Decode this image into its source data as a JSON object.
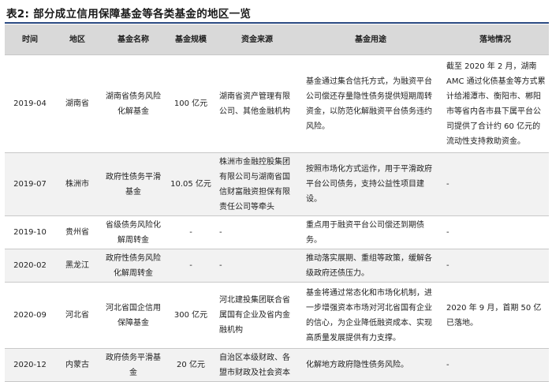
{
  "title": "表2: 部分成立信用保障基金等各类基金的地区一览",
  "headers": [
    "时间",
    "地区",
    "基金名称",
    "基金规模",
    "资金来源",
    "基金用途",
    "落地情况"
  ],
  "rows": [
    {
      "time": "2019-04",
      "region": "湖南省",
      "name": "湖南省债务风险化解基金",
      "scale": "100 亿元",
      "source": "湖南省资产管理有限公司、其他金融机构",
      "purpose": "基金通过集合信托方式，为融资平台公司偿还存量隐性债务提供短期周转资金，以防范化解融资平台债务违约风险。",
      "status": "截至 2020 年 2 月，湖南 AMC 通过化债基金等方式累计给湘潭市、衡阳市、郴阳市等省内各市县下属平台公司提供了合计约 60 亿元的流动性支持救助资金。"
    },
    {
      "time": "2019-07",
      "region": "株洲市",
      "name": "政府性债务平滑基金",
      "scale": "10.05 亿元",
      "source": "株洲市金融控股集团有限公司与湖南省国信财富融资担保有限责任公司等牵头",
      "purpose": "按照市场化方式运作，用于平滑政府平台公司债务，支持公益性项目建设。",
      "status": "-"
    },
    {
      "time": "2019-10",
      "region": "贵州省",
      "name": "省级债务风险化解周转金",
      "scale": "-",
      "source": "-",
      "purpose": "重点用于融资平台公司偿还到期债务。",
      "status": "-"
    },
    {
      "time": "2020-02",
      "region": "黑龙江",
      "name": "政府性债务风险化解周转金",
      "scale": "-",
      "source": "-",
      "purpose": "推动落实展期、重组等政策，缓解各级政府还债压力。",
      "status": "-"
    },
    {
      "time": "2020-09",
      "region": "河北省",
      "name": "河北省国企信用保障基金",
      "scale": "300 亿元",
      "source": "河北建投集团联合省属国有企业及省内金融机构",
      "purpose": "基金将通过常态化和市场化机制，进一步增强资本市场对河北省国有企业的信心，为企业降低融资成本、实现高质量发展提供有力支撑。",
      "status": "2020 年 9 月，首期 50 亿已落地。"
    },
    {
      "time": "2020-12",
      "region": "内蒙古",
      "name": "政府债务平滑基金",
      "scale": "20 亿元",
      "source": "自治区本级财政、各盟市财政及社会资本",
      "purpose": "化解地方政府隐性债务风险。",
      "status": "-"
    }
  ]
}
